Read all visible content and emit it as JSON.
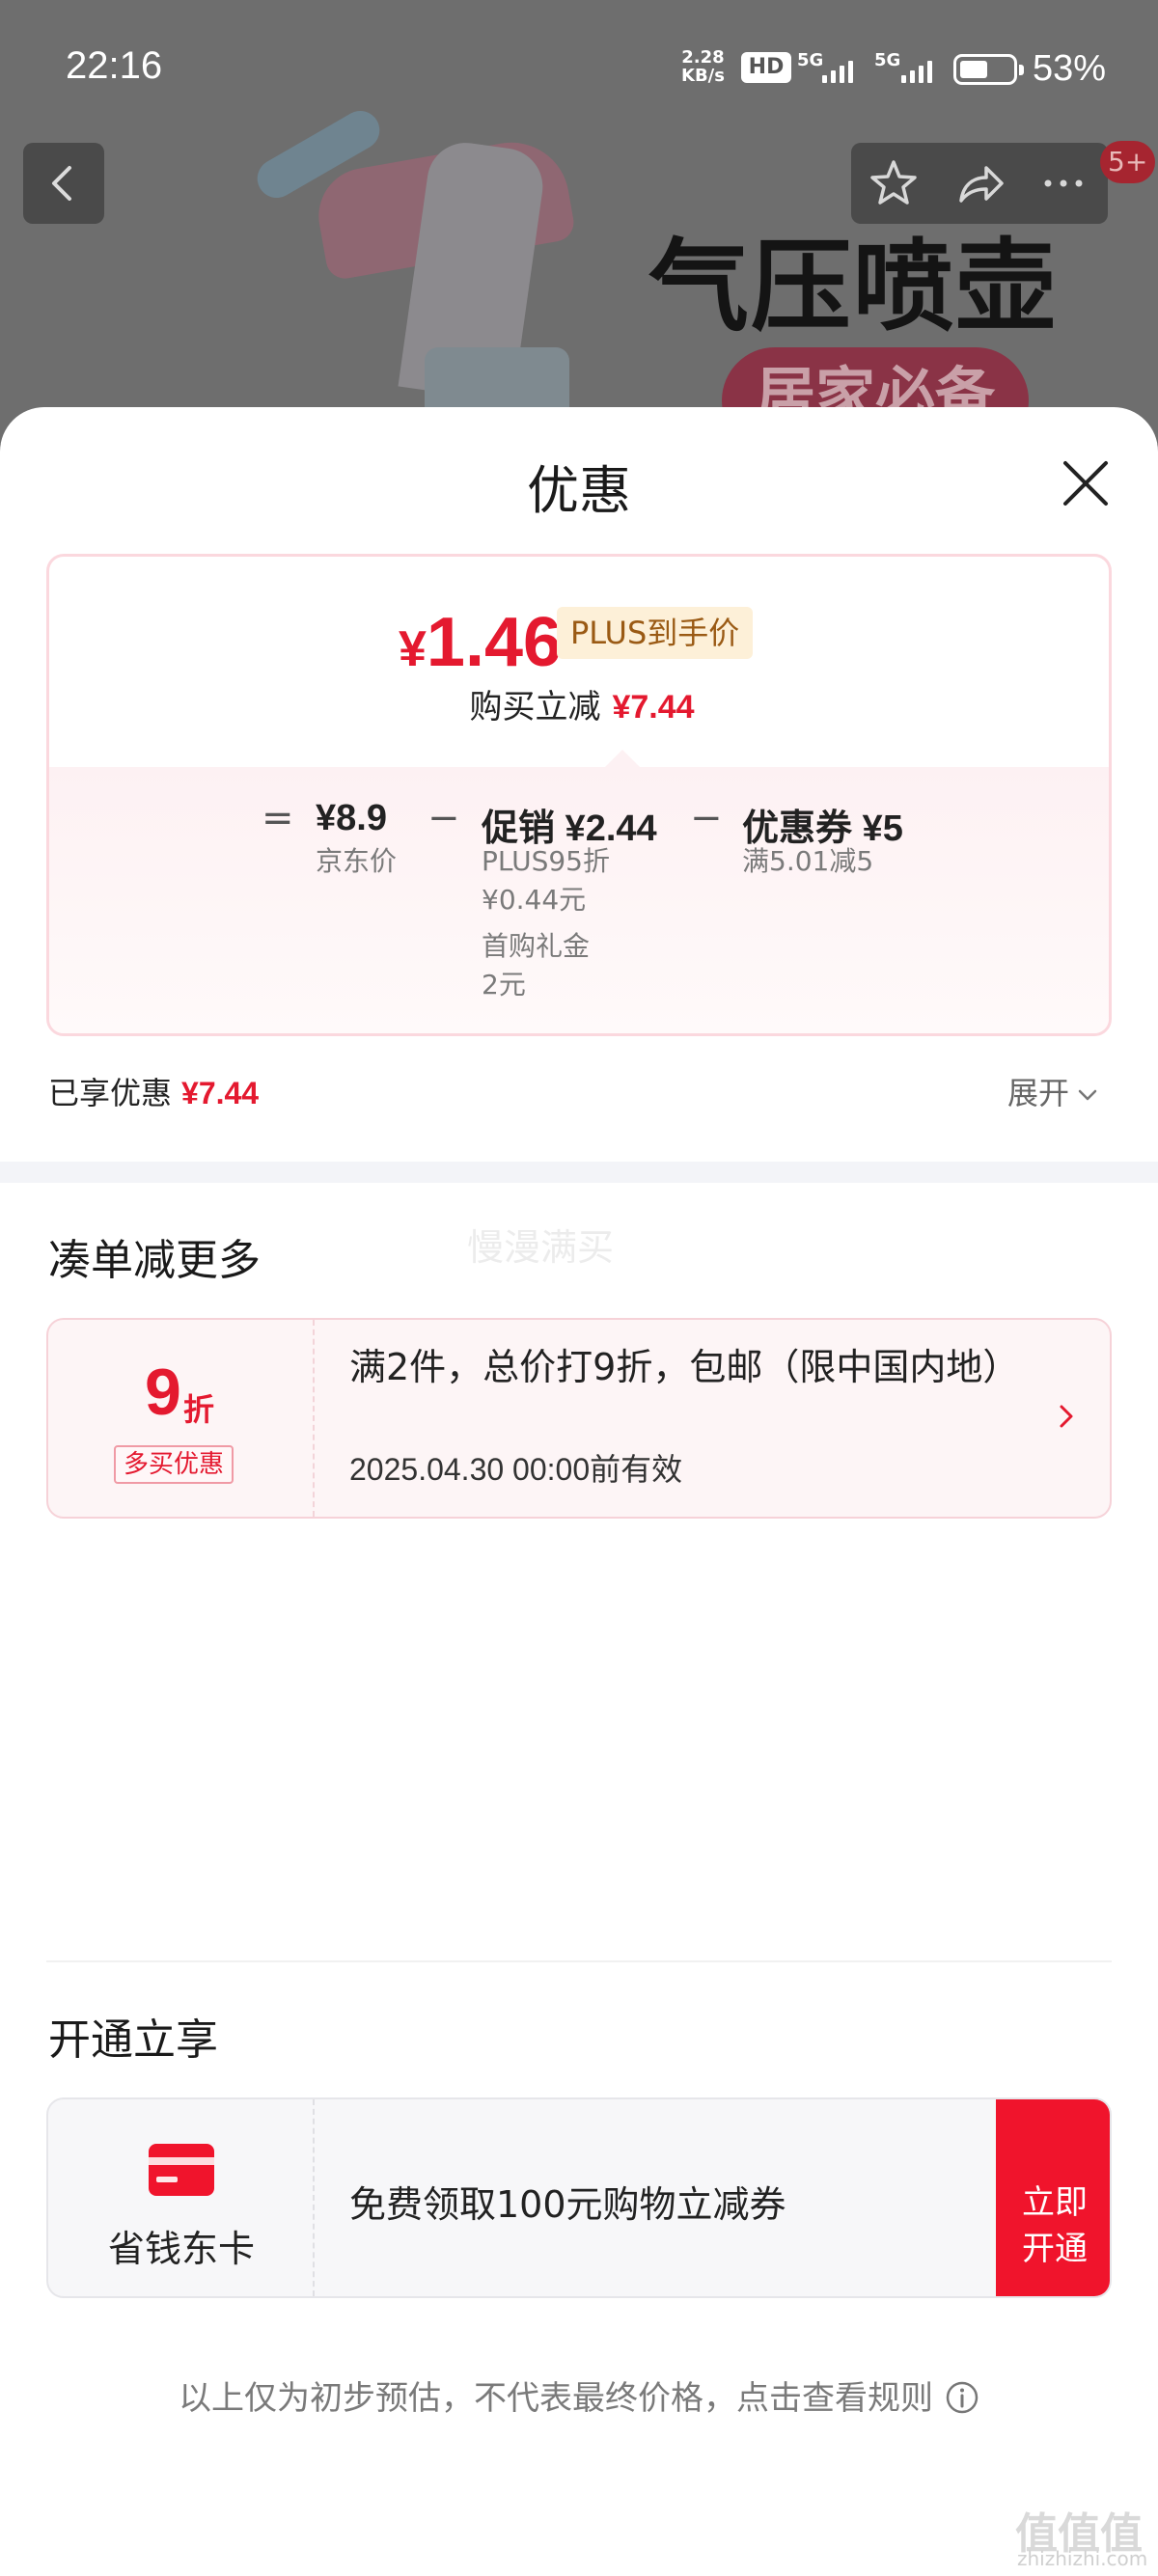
{
  "status_bar": {
    "time": "22:16",
    "net_speed_value": "2.28",
    "net_speed_unit": "KB/s",
    "hd": "HD",
    "signal1": "5G",
    "signal2": "5G",
    "battery_percent": "53%",
    "battery_level": 0.53
  },
  "background": {
    "product_title": "气压喷壶",
    "product_pill": "居家必备",
    "notification_badge": "5+"
  },
  "sheet": {
    "title": "优惠",
    "price": {
      "currency": "¥",
      "amount": "1.46",
      "tag": "PLUS到手价",
      "save_label": "购买立减",
      "save_amount": "¥7.44"
    },
    "formula": {
      "equals": "=",
      "base_value": "¥8.9",
      "base_label": "京东价",
      "minus1": "−",
      "promo_title": "促销 ¥2.44",
      "promo_detail_1a": "PLUS95折",
      "promo_detail_1b": "¥0.44元",
      "promo_detail_2a": "首购礼金",
      "promo_detail_2b": "2元",
      "minus2": "−",
      "coupon_title": "优惠券 ¥5",
      "coupon_detail": "满5.01减5"
    },
    "enjoyed_label": "已享优惠",
    "enjoyed_amount": "¥7.44",
    "expand_label": "展开"
  },
  "bundle": {
    "section_title": "凑单减更多",
    "watermark": "慢漫满买",
    "discount_number": "9",
    "discount_unit": "折",
    "discount_tag": "多买优惠",
    "description": "满2件，总价打9折，包邮（限中国内地）",
    "valid_until": "2025.04.30 00:00前有效"
  },
  "membership": {
    "section_title": "开通立享",
    "card_name": "省钱东卡",
    "offer": "免费领取100元购物立减券",
    "button_label_line1": "立即",
    "button_label_line2": "开通"
  },
  "disclaimer": "以上仅为初步预估，不代表最终价格，点击查看规则",
  "corner_watermark": "值值值",
  "corner_watermark_sub": "zhizhizhi.com",
  "icons": {
    "back": "chevron-left-icon",
    "favorite": "star-icon",
    "share": "share-icon",
    "more": "more-icon",
    "close": "close-icon",
    "expand": "chevron-down-icon",
    "coupon_arrow": "chevron-right-icon",
    "card": "card-icon",
    "info": "info-icon"
  },
  "colors": {
    "accent_red": "#e4192f",
    "button_red": "#f0142c",
    "plus_tag_bg": "#fdf0d8",
    "plus_tag_text": "#9a5a14"
  }
}
